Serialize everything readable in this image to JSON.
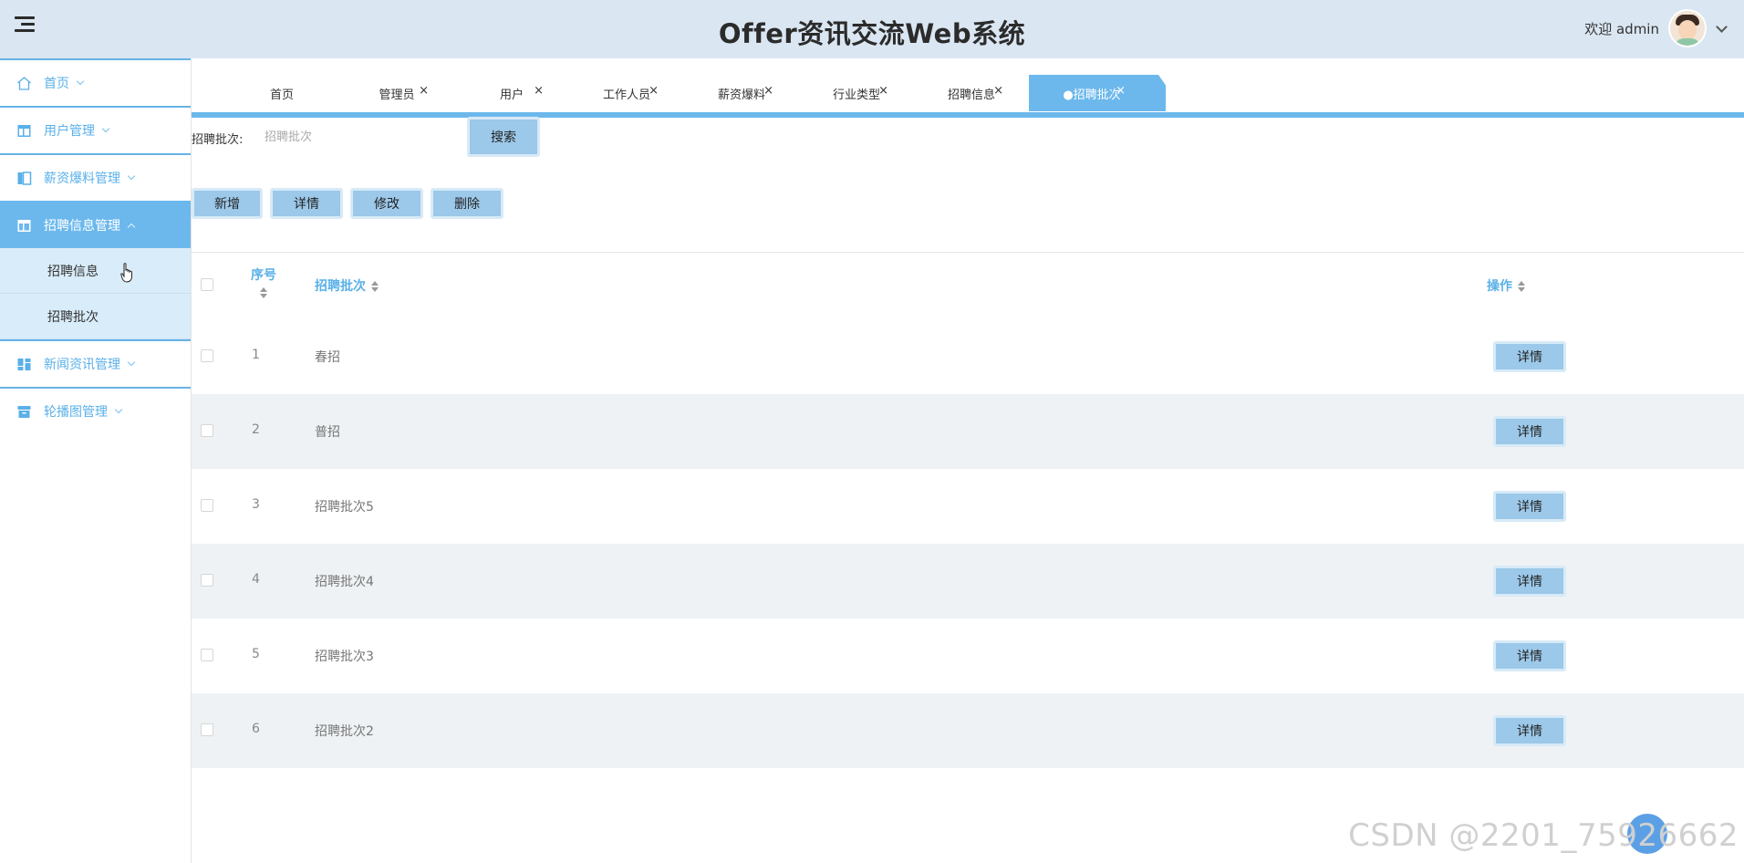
{
  "header": {
    "title": "Offer资讯交流Web系统",
    "welcome": "欢迎 admin"
  },
  "sidebar": {
    "items": [
      {
        "label": "首页",
        "icon": "home-icon"
      },
      {
        "label": "用户管理",
        "icon": "table-icon"
      },
      {
        "label": "薪资爆料管理",
        "icon": "columns-icon"
      },
      {
        "label": "招聘信息管理",
        "icon": "table-icon",
        "active": true
      },
      {
        "label": "新闻资讯管理",
        "icon": "dashboard-icon"
      },
      {
        "label": "轮播图管理",
        "icon": "archive-icon"
      }
    ],
    "subitems": [
      "招聘信息",
      "招聘批次"
    ]
  },
  "tabs": [
    {
      "label": "首页"
    },
    {
      "label": "管理员"
    },
    {
      "label": "用户"
    },
    {
      "label": "工作人员"
    },
    {
      "label": "薪资爆料"
    },
    {
      "label": "行业类型"
    },
    {
      "label": "招聘信息"
    },
    {
      "label": "●招聘批次",
      "active": true
    }
  ],
  "tab_close": "×",
  "search": {
    "label": "招聘批次:",
    "placeholder": "招聘批次",
    "button": "搜索"
  },
  "actions": {
    "add": "新增",
    "detail": "详情",
    "edit": "修改",
    "delete": "删除"
  },
  "table": {
    "headers": {
      "index": "序号",
      "batch": "招聘批次",
      "ops": "操作"
    },
    "rows": [
      {
        "no": "1",
        "name": "春招",
        "op": "详情"
      },
      {
        "no": "2",
        "name": "普招",
        "op": "详情"
      },
      {
        "no": "3",
        "name": "招聘批次5",
        "op": "详情"
      },
      {
        "no": "4",
        "name": "招聘批次4",
        "op": "详情"
      },
      {
        "no": "5",
        "name": "招聘批次3",
        "op": "详情"
      },
      {
        "no": "6",
        "name": "招聘批次2",
        "op": "详情"
      }
    ]
  },
  "watermark": "CSDN @2201_75926662",
  "colors": {
    "accent": "#6cb8ed",
    "header_bg": "#dae6f2",
    "submenu_bg": "#d9ecf9",
    "button_bg": "#9cc8e9",
    "row_alt": "#eef2f4"
  }
}
